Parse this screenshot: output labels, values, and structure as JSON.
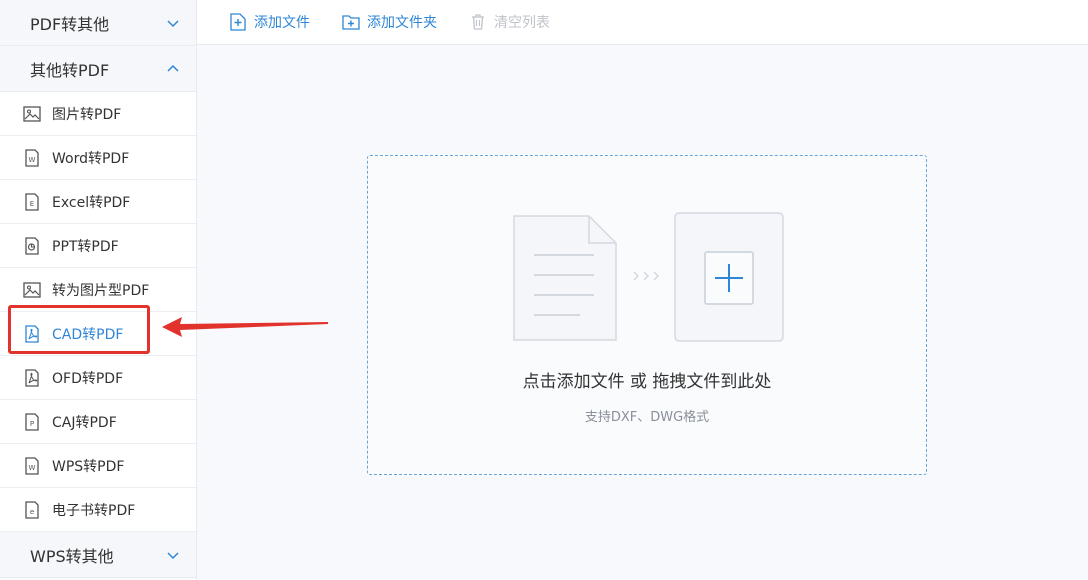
{
  "sidebar": {
    "groups": [
      {
        "label": "PDF转其他"
      },
      {
        "label": "其他转PDF"
      },
      {
        "label": "WPS转其他"
      }
    ],
    "items": [
      {
        "label": "图片转PDF",
        "icon": "image-icon"
      },
      {
        "label": "Word转PDF",
        "icon": "word-icon"
      },
      {
        "label": "Excel转PDF",
        "icon": "excel-icon"
      },
      {
        "label": "PPT转PDF",
        "icon": "ppt-icon"
      },
      {
        "label": "转为图片型PDF",
        "icon": "image-icon"
      },
      {
        "label": "CAD转PDF",
        "icon": "pdf-icon",
        "active": true
      },
      {
        "label": "OFD转PDF",
        "icon": "pdf-icon"
      },
      {
        "label": "CAJ转PDF",
        "icon": "caj-icon"
      },
      {
        "label": "WPS转PDF",
        "icon": "wps-icon"
      },
      {
        "label": "电子书转PDF",
        "icon": "ebook-icon"
      }
    ]
  },
  "toolbar": {
    "add_file": "添加文件",
    "add_folder": "添加文件夹",
    "clear_list": "清空列表"
  },
  "dropzone": {
    "main_text": "点击添加文件 或 拖拽文件到此处",
    "sub_text": "支持DXF、DWG格式"
  },
  "colors": {
    "accent": "#2f86d6",
    "highlight": "#e2322c",
    "disabled": "#bfc4cb"
  }
}
